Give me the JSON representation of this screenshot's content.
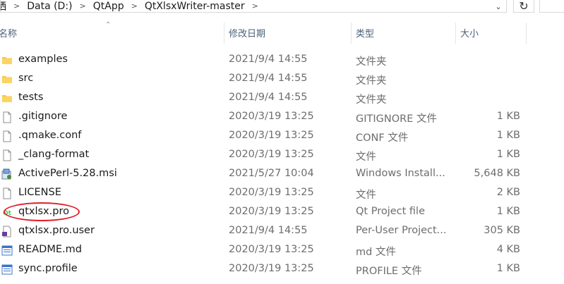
{
  "address_bar": {
    "segments": [
      "晒",
      "Data (D:)",
      "QtApp",
      "QtXlsxWriter-master"
    ]
  },
  "columns": {
    "name": "名称",
    "date": "修改日期",
    "type": "类型",
    "size": "大小"
  },
  "files": [
    {
      "name": "examples",
      "date": "2021/9/4 14:55",
      "type": "文件夹",
      "size": "",
      "icon": "folder-icon"
    },
    {
      "name": "src",
      "date": "2021/9/4 14:55",
      "type": "文件夹",
      "size": "",
      "icon": "folder-icon"
    },
    {
      "name": "tests",
      "date": "2021/9/4 14:55",
      "type": "文件夹",
      "size": "",
      "icon": "folder-icon"
    },
    {
      "name": ".gitignore",
      "date": "2020/3/19 13:25",
      "type": "GITIGNORE 文件",
      "size": "1 KB",
      "icon": "file-icon"
    },
    {
      "name": ".qmake.conf",
      "date": "2020/3/19 13:25",
      "type": "CONF 文件",
      "size": "1 KB",
      "icon": "file-icon"
    },
    {
      "name": "_clang-format",
      "date": "2020/3/19 13:25",
      "type": "文件",
      "size": "1 KB",
      "icon": "file-icon"
    },
    {
      "name": "ActivePerl-5.28.msi",
      "date": "2021/5/27 10:04",
      "type": "Windows Install...",
      "size": "5,648 KB",
      "icon": "installer-icon"
    },
    {
      "name": "LICENSE",
      "date": "2020/3/19 13:25",
      "type": "文件",
      "size": "2 KB",
      "icon": "file-icon"
    },
    {
      "name": "qtxlsx.pro",
      "date": "2020/3/19 13:25",
      "type": "Qt Project file",
      "size": "1 KB",
      "icon": "qt-project-icon"
    },
    {
      "name": "qtxlsx.pro.user",
      "date": "2021/9/4 14:55",
      "type": "Per-User Project...",
      "size": "305 KB",
      "icon": "user-file-icon"
    },
    {
      "name": "README.md",
      "date": "2020/3/19 13:25",
      "type": "md 文件",
      "size": "4 KB",
      "icon": "document-icon"
    },
    {
      "name": "sync.profile",
      "date": "2020/3/19 13:25",
      "type": "PROFILE 文件",
      "size": "1 KB",
      "icon": "document-icon"
    }
  ],
  "colors": {
    "folder": "#f8c63d",
    "highlight_ellipse": "#e21f2b",
    "header_text": "#4c607a"
  }
}
